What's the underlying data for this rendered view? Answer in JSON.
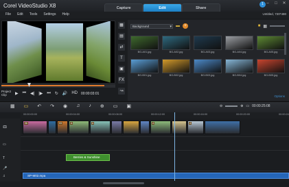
{
  "app": {
    "title": "Corel VideoStudio X8",
    "project_info": "Untitled, 720*480",
    "notification_count": "1"
  },
  "tabs": [
    {
      "label": "Capture"
    },
    {
      "label": "Edit",
      "active": true
    },
    {
      "label": "Share"
    }
  ],
  "menu": [
    "File",
    "Edit",
    "Tools",
    "Settings",
    "Help"
  ],
  "preview": {
    "mode_project": "Project",
    "mode_clip": "Clip",
    "timecode": "00:00:03:01",
    "hd_label": "HD"
  },
  "library": {
    "dropdown_value": "Background",
    "options_label": "Options",
    "thumbnails": [
      {
        "caption": "BG-A01.jpg",
        "color": "#3f6a2e"
      },
      {
        "caption": "BG-A02.jpg",
        "color": "#2f6a80"
      },
      {
        "caption": "BG-A03.jpg",
        "color": "#1f3a4e"
      },
      {
        "caption": "BG-A04.jpg",
        "color": "#9b9ea3"
      },
      {
        "caption": "BG-A05.jpg",
        "color": "#5e8a34"
      },
      {
        "caption": "BG-B01.jpg",
        "color": "#5a9ed6"
      },
      {
        "caption": "BG-B02.jpg",
        "color": "#d39a2b"
      },
      {
        "caption": "BG-B03.jpg",
        "color": "#4c8ac9"
      },
      {
        "caption": "BG-B04.jpg",
        "color": "#87b7d8"
      },
      {
        "caption": "BG-B05.jpg",
        "color": "#c9452f"
      }
    ]
  },
  "timeline": {
    "timecode": "00:00:25:08",
    "ruler": [
      "00:00:00:00",
      "00:00:04:00",
      "00:00:08:00",
      "00:00:12:00",
      "00:00:16:00",
      "00:00:20:00",
      "00:00:24:00"
    ],
    "video_clips": [
      {
        "color": "#c96aa0",
        "label": "06"
      },
      {
        "color": "#2f6ca0",
        "label": ""
      },
      {
        "color": "#d1782c",
        "label": "03"
      },
      {
        "color": "#8fb978",
        "label": "A"
      },
      {
        "color": "#87c2b7",
        "label": "A"
      },
      {
        "color": "#7a7aa6",
        "label": ""
      },
      {
        "color": "#d9a640",
        "label": ""
      },
      {
        "color": "#5f86c4",
        "label": ""
      },
      {
        "color": "#8dbb7a",
        "label": "A"
      },
      {
        "color": "#d6c58f",
        "label": ""
      },
      {
        "color": "#b8c8d6",
        "label": "A"
      },
      {
        "color": "#3f6fa6",
        "label": ""
      }
    ],
    "title_clip": "Berries & Sunshine",
    "audio_clip": "SP-M02.mpa"
  },
  "colors": {
    "accent": "#1c7fc4",
    "orange": "#e07a2c",
    "title_track": "#3f8f2e",
    "audio_track": "#2566b8"
  }
}
